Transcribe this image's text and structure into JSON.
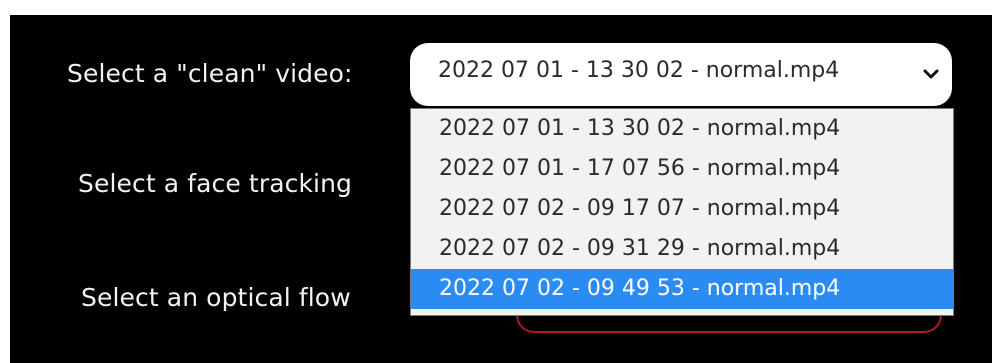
{
  "labels": {
    "clean_video": "Select a \"clean\" video:",
    "face_tracking": "Select a face tracking",
    "optical_flow": "Select an optical flow"
  },
  "clean_video_select": {
    "value": "2022 07 01 - 13 30 02 - normal.mp4",
    "icon": "chevron-down-icon",
    "options": [
      "2022 07 01 - 13 30 02 - normal.mp4",
      "2022 07 01 - 17 07 56 - normal.mp4",
      "2022 07 02 - 09 17 07 - normal.mp4",
      "2022 07 02 - 09 31 29 - normal.mp4",
      "2022 07 02 - 09 49 53 - normal.mp4"
    ],
    "highlighted_index": 4
  },
  "colors": {
    "background": "#000000",
    "highlight": "#2a8cf2",
    "accent_border": "#b2162a"
  }
}
